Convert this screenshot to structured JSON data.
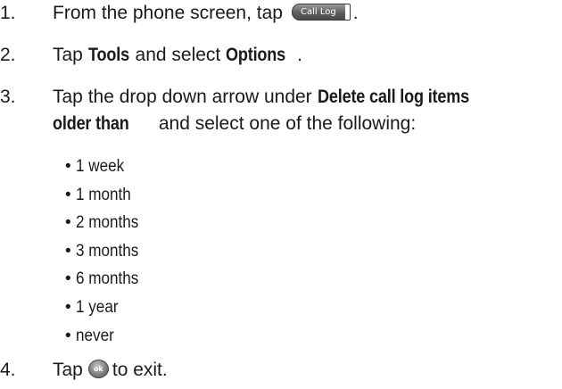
{
  "steps": [
    {
      "num": "1.",
      "text_before": "From the phone screen, tap",
      "softkey_label": "Call Log",
      "text_after": "."
    },
    {
      "num": "2.",
      "text_a": "Tap ",
      "bold_a": "Tools",
      "text_b": " and select ",
      "bold_b": "Options",
      "text_c": "."
    },
    {
      "num": "3.",
      "text_a": "Tap the drop down arrow under ",
      "bold_line1": "Delete call log items",
      "bold_line2": "older than",
      "text_b": " and select one of the following:"
    },
    {
      "num": "4.",
      "text_a": "Tap",
      "ok_label": "ok",
      "text_b": "to exit."
    }
  ],
  "options": [
    "1 week",
    "1 month",
    "2 months",
    "3 months",
    "6 months",
    "1 year",
    "never"
  ],
  "bullet_char": "•"
}
